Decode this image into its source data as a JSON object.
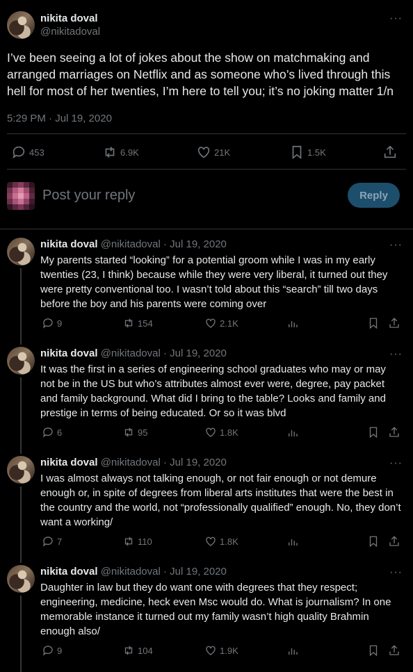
{
  "main_tweet": {
    "author_name": "nikita doval",
    "author_handle": "@nikitadoval",
    "text": "I’ve been seeing a lot of jokes about the show on matchmaking and arranged marriages on Netflix and as someone who’s lived through this hell for most of her twenties, I’m here to tell you; it’s no joking matter 1/n",
    "timestamp": "5:29 PM · Jul 19, 2020",
    "replies": "453",
    "retweets": "6.9K",
    "likes": "21K",
    "bookmarks": "1.5K",
    "more_icon": "more-horizontal-icon"
  },
  "composer": {
    "placeholder": "Post your reply",
    "button_label": "Reply"
  },
  "thread": [
    {
      "author_name": "nikita doval",
      "author_handle": "@nikitadoval",
      "date": "· Jul 19, 2020",
      "text": "My parents started “looking” for a potential groom while I was in my early twenties (23, I think) because while they were very liberal, it turned out they were pretty conventional too. I wasn’t told about this “search” till two days before the boy and his parents were coming over",
      "replies": "9",
      "retweets": "154",
      "likes": "2.1K"
    },
    {
      "author_name": "nikita doval",
      "author_handle": "@nikitadoval",
      "date": "· Jul 19, 2020",
      "text": "It was the first in a series of engineering school graduates who may or may not be in the US but who’s attributes almost ever were, degree, pay packet and family background. What did I bring to the table? Looks and family and prestige in terms of being educated. Or so it was blvd",
      "replies": "6",
      "retweets": "95",
      "likes": "1.8K"
    },
    {
      "author_name": "nikita doval",
      "author_handle": "@nikitadoval",
      "date": "· Jul 19, 2020",
      "text": "I was almost always not talking enough, or not fair enough or not demure enough or, in spite of degrees from liberal arts institutes that were the best in the country and the world, not “professionally qualified” enough. No, they don’t want a working/",
      "replies": "7",
      "retweets": "110",
      "likes": "1.8K"
    },
    {
      "author_name": "nikita doval",
      "author_handle": "@nikitadoval",
      "date": "· Jul 19, 2020",
      "text": "Daughter in law but they do want one with degrees that they respect; engineering, medicine, heck even Msc would do. What is journalism? In one memorable instance it turned out my family wasn’t high quality Brahmin enough also/",
      "replies": "9",
      "retweets": "104",
      "likes": "1.9K"
    }
  ],
  "colors": {
    "background": "#000000",
    "text": "#e7e9ea",
    "muted": "#71767b",
    "divider": "#2f3336",
    "reply_button": "#1d4f6d"
  }
}
